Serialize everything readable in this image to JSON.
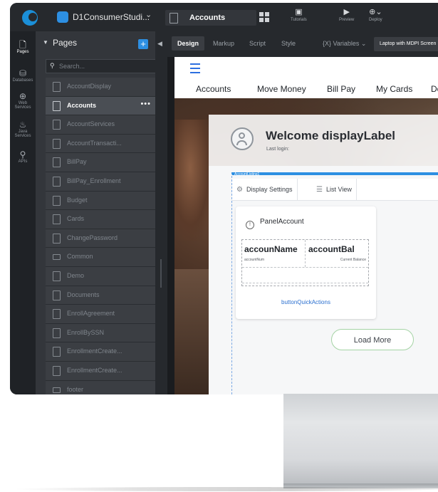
{
  "app": {
    "project_name": "D1ConsumerStudi...",
    "active_page_tab": "Accounts"
  },
  "toolbar": {
    "tutorials": "Tutorials",
    "preview": "Preview",
    "deploy": "Deploy"
  },
  "rail": {
    "items": [
      {
        "label": "Pages",
        "icon": "page-icon"
      },
      {
        "label": "Databases",
        "icon": "database-icon"
      },
      {
        "label": "Web Services",
        "icon": "globe-icon"
      },
      {
        "label": "Java Services",
        "icon": "java-icon"
      },
      {
        "label": "APIs",
        "icon": "api-icon"
      }
    ]
  },
  "pages_panel": {
    "title": "Pages",
    "search_placeholder": "Search...",
    "items": [
      {
        "label": "AccountDisplay"
      },
      {
        "label": "Accounts"
      },
      {
        "label": "AccountServices"
      },
      {
        "label": "AccountTransacti..."
      },
      {
        "label": "BillPay"
      },
      {
        "label": "BillPay_Enrollment"
      },
      {
        "label": "Budget"
      },
      {
        "label": "Cards"
      },
      {
        "label": "ChangePassword"
      },
      {
        "label": "Common"
      },
      {
        "label": "Demo"
      },
      {
        "label": "Documents"
      },
      {
        "label": "EnrollAgreement"
      },
      {
        "label": "EnrollBySSN"
      },
      {
        "label": "EnrollmentCreate..."
      },
      {
        "label": "EnrollmentCreate..."
      },
      {
        "label": "footer"
      }
    ],
    "active_item": "Accounts",
    "active_more": "•••"
  },
  "editor": {
    "tabs": [
      "Design",
      "Markup",
      "Script",
      "Style"
    ],
    "variables": "{X} Variables ⌄",
    "device": "Laptop with MDPI Screen"
  },
  "canvas": {
    "nav_tabs": [
      "Accounts",
      "Move Money",
      "Bill Pay",
      "My Cards",
      "Doc"
    ],
    "welcome_title": "Welcome displayLabel",
    "last_login": "Last login:",
    "listing_tag": "AccountListing1",
    "display_settings": "Display Settings",
    "list_view": "List View",
    "panel_label": "PanelAccount",
    "account_name": "accounName",
    "account_num": "accountNum",
    "account_balance": "accountBal",
    "current_balance": "Current Balance",
    "quick_actions": "buttonQuickActions",
    "load_more": "Load More"
  },
  "colors": {
    "accent": "#2d8fe2",
    "load_more_border": "#a4d3a4"
  }
}
